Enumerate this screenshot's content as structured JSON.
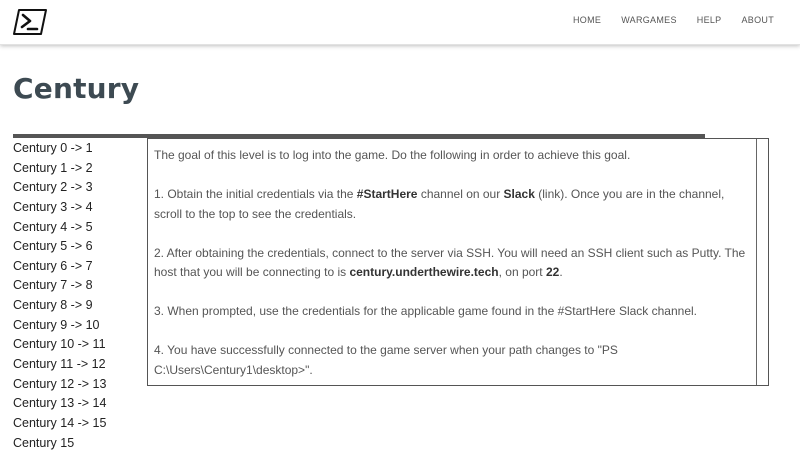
{
  "nav": {
    "logo_icon": "powershell-prompt-icon",
    "links": [
      "HOME",
      "WARGAMES",
      "HELP",
      "ABOUT"
    ]
  },
  "page": {
    "title": "Century"
  },
  "sidebar": {
    "items": [
      "Century 0 -> 1",
      "Century 1 -> 2",
      "Century 2 -> 3",
      "Century 3 -> 4",
      "Century 4 -> 5",
      "Century 5 -> 6",
      "Century 6 -> 7",
      "Century 7 -> 8",
      "Century 8 -> 9",
      "Century 9 -> 10",
      "Century 10 -> 11",
      "Century 11 -> 12",
      "Century 12 -> 13",
      "Century 13 -> 14",
      "Century 14 -> 15",
      "Century 15"
    ]
  },
  "content": {
    "intro": "The goal of this level is to log into the game. Do the following in order to achieve this goal.",
    "step1": {
      "before": "1. Obtain the initial credentials via the ",
      "channel": "#StartHere",
      "middle": " channel on our ",
      "slack": "Slack",
      "after": " (link). Once you are in the channel, scroll to the top to see the credentials."
    },
    "step2": {
      "before": "2. After obtaining the credentials, connect to the server via SSH. You will need an SSH client such as Putty. The host that you will be connecting to is ",
      "host": "century.underthewire.tech",
      "middle": ", on port ",
      "port": "22",
      "after": "."
    },
    "step3": "3. When prompted, use the credentials for the applicable game found in the #StartHere Slack channel.",
    "step4": "4. You have successfully connected to the game server when your path changes to \"PS C:\\Users\\Century1\\desktop>\"."
  }
}
